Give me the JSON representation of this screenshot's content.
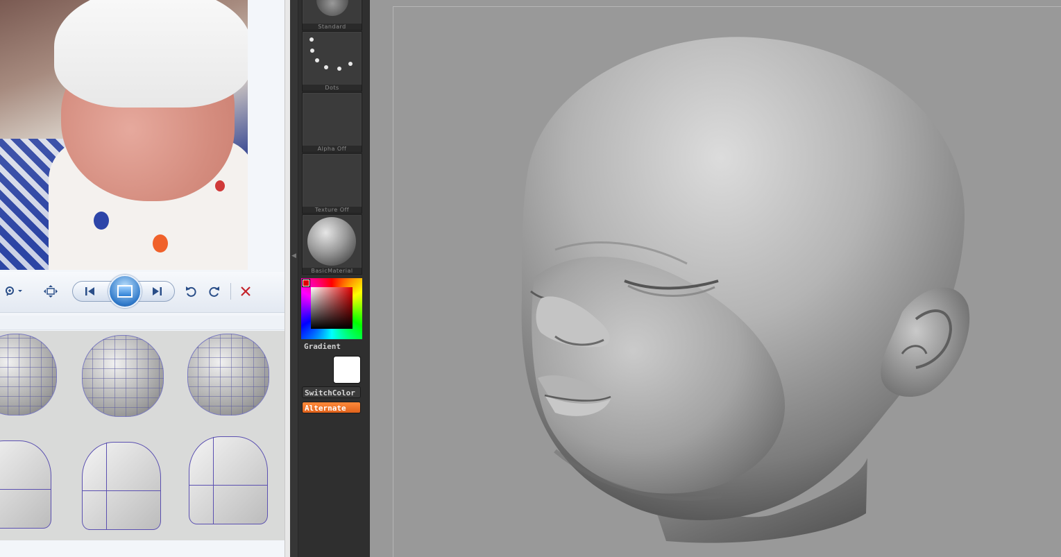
{
  "viewer": {
    "toolbar": {
      "zoom_icon": "zoom-icon",
      "fit_icon": "fit-window-icon",
      "prev_icon": "previous-icon",
      "slideshow_icon": "slideshow-icon",
      "next_icon": "next-icon",
      "rotate_ccw_icon": "rotate-counterclockwise-icon",
      "rotate_cw_icon": "rotate-clockwise-icon",
      "delete_icon": "delete-icon"
    }
  },
  "shelf": {
    "brush_label": "Standard",
    "stroke_label": "Dots",
    "alpha_label": "Alpha  Off",
    "texture_label": "Texture  Off",
    "material_label": "BasicMaterial",
    "gradient_label": "Gradient",
    "switchcolor_label": "SwitchColor",
    "alternate_label": "Alternate"
  },
  "colors": {
    "shelf_bg": "#2f2f2f",
    "viewport_bg": "#999999",
    "accent_orange": "#ff8a3a",
    "main_color": "#ff0000",
    "secondary_color": "#ffffff"
  }
}
